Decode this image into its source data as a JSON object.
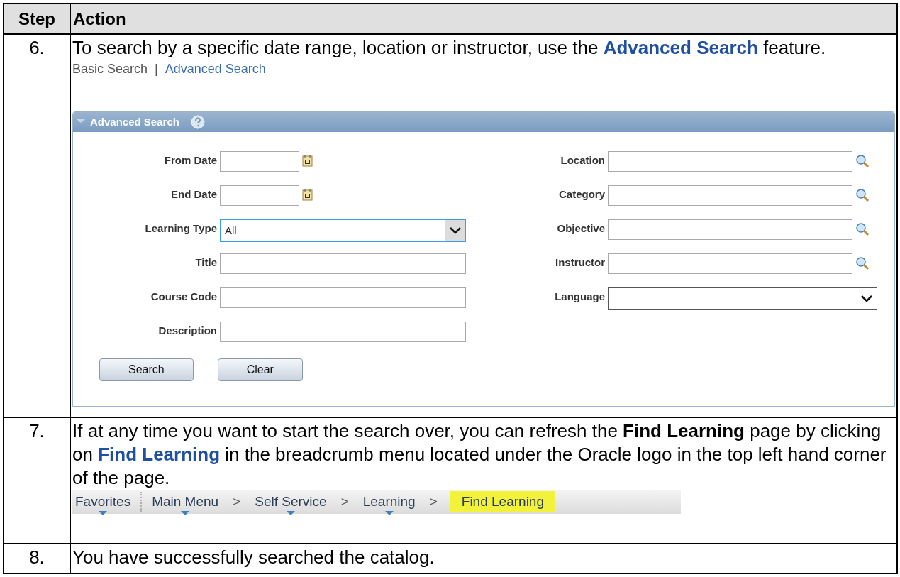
{
  "table": {
    "columns": [
      "Step",
      "Action"
    ],
    "rows": [
      {
        "step": "6.",
        "text_before": "To search by a specific date range, location or instructor, use the ",
        "link": "Advanced Search",
        "text_after": " feature.",
        "search_links": [
          {
            "label": "Basic Search",
            "selected": true
          },
          {
            "label": "Advanced Search",
            "selected": false
          }
        ],
        "separator": "|",
        "panel": {
          "title": "Advanced Search",
          "left_fields": [
            {
              "label": "From Date",
              "kind": "date"
            },
            {
              "label": "End Date",
              "kind": "date"
            },
            {
              "label": "Learning Type",
              "kind": "select",
              "value": "All",
              "focused": true
            },
            {
              "label": "Title",
              "kind": "text"
            },
            {
              "label": "Course Code",
              "kind": "text"
            },
            {
              "label": "Description",
              "kind": "text"
            }
          ],
          "right_fields": [
            {
              "label": "Location",
              "kind": "lookup"
            },
            {
              "label": "Category",
              "kind": "lookup"
            },
            {
              "label": "Objective",
              "kind": "lookup"
            },
            {
              "label": "Instructor",
              "kind": "lookup"
            },
            {
              "label": "Language",
              "kind": "select"
            }
          ],
          "buttons": [
            "Search",
            "Clear"
          ]
        }
      },
      {
        "step": "7.",
        "text_before": "If at any time you want to start the search over, you can refresh the **Find Learning** page by clicking on ",
        "link": "Find Learning",
        "text_after": " in the breadcrumb menu located under the Oracle logo in the top left hand corner of the page.",
        "breadcrumb": [
          {
            "label": "Favorites",
            "has_menu": true,
            "highlighted": false,
            "kind": "divider"
          },
          {
            "label": "Main Menu",
            "has_menu": true,
            "highlighted": false,
            "separator": ">"
          },
          {
            "label": "Self Service",
            "has_menu": true,
            "highlighted": false,
            "separator": ">"
          },
          {
            "label": "Learning",
            "has_menu": true,
            "highlighted": false,
            "separator": ">"
          },
          {
            "label": "Find Learning",
            "has_menu": false,
            "highlighted": true
          }
        ]
      },
      {
        "step": "8.",
        "text_before": "You have successfully searched the catalog."
      }
    ]
  }
}
